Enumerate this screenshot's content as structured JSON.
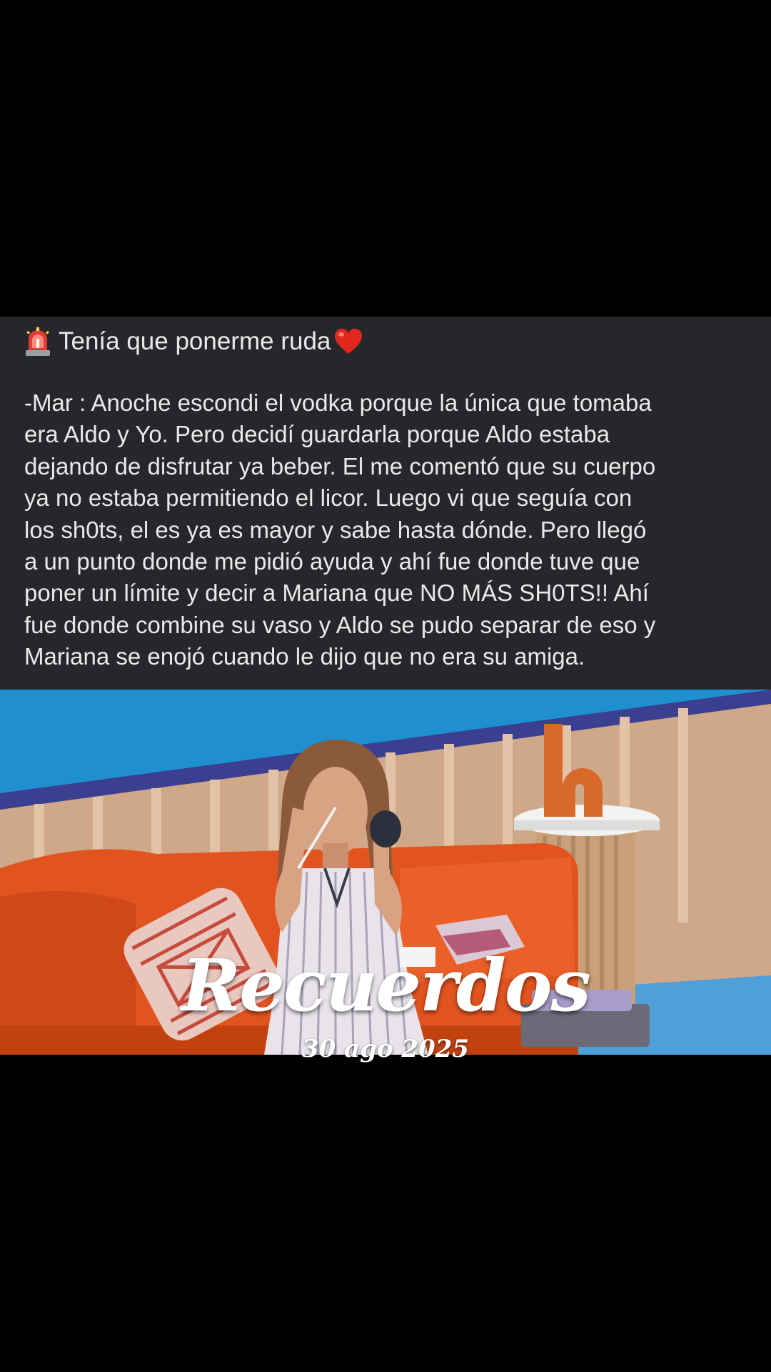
{
  "post": {
    "icon_left": "police-siren-icon",
    "headline": "Tenía que ponerme ruda",
    "icon_right": "red-heart-icon",
    "body": "-Mar : Anoche escondi el vodka porque la única que tomaba\nera Aldo y Yo. Pero decidí guardarla porque Aldo estaba\ndejando de disfrutar ya beber. El me comentó que su cuerpo\nya no estaba permitiendo el licor. Luego vi que seguía con\nlos sh0ts, el es ya es mayor y sabe hasta dónde. Pero llegó\na un punto donde me pidió ayuda y ahí fue donde tuve que\nponer un límite y decir a Mariana que NO MÁS SH0TS!!  Ahí\nfue donde combine su vaso y Aldo se pudo separar de eso y\nMariana se enojó cuando le dijo que no era su amiga."
  },
  "video": {
    "overlay_title": "Recuerdos",
    "overlay_date": "30 ago 2025"
  },
  "colors": {
    "background": "#000000",
    "panel": "#25272a",
    "text": "#e9e9ea",
    "sofa": "#e2541f",
    "wall_blue": "#1f8fcf"
  }
}
